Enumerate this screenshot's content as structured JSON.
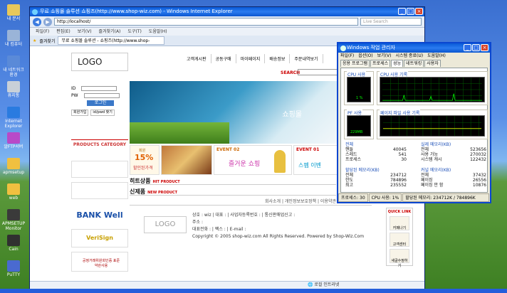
{
  "desktop_icons": [
    {
      "label": "내 문서",
      "color": "#e8c85a"
    },
    {
      "label": "내 컴퓨터",
      "color": "#9ab4d8"
    },
    {
      "label": "내 네트워크 환경",
      "color": "#5a8ad8"
    },
    {
      "label": "휴지통",
      "color": "#c8d0d8"
    },
    {
      "label": "Internet Explorer",
      "color": "#2a7be0"
    },
    {
      "label": "알FTP서버",
      "color": "#b84ac8"
    },
    {
      "label": "apmsetup",
      "color": "#f0c040"
    },
    {
      "label": "web",
      "color": "#f0c040"
    },
    {
      "label": "APMSETUP Monitor",
      "color": "#3a3a3a"
    },
    {
      "label": "Cain",
      "color": "#303030"
    },
    {
      "label": "PuTTY",
      "color": "#4a6ad0"
    }
  ],
  "ie": {
    "title": "무료 쇼핑몰 솔루션  쇼핑즈(http://www.shop-wiz.com) - Windows Internet Explorer",
    "url": "http://localhost/",
    "search_placeholder": "Live Search",
    "menu": [
      "파일(F)",
      "편집(E)",
      "보기(V)",
      "즐겨찾기(A)",
      "도구(T)",
      "도움말(H)"
    ],
    "favorites": "즐겨찾기",
    "tab_label": "무료 쇼핑몰 솔루션 - 쇼핑즈(http://www.shop-",
    "status": "로컬 인트라넷"
  },
  "site": {
    "logo": "LOGO",
    "gnb": [
      "고객게시판",
      "공동구매",
      "마이페이지",
      "배송정보",
      "주문내역보기"
    ],
    "search_label": "SEARCH",
    "login": {
      "id_label": "ID",
      "pw_label": "PW",
      "button": "로그인",
      "join": "회원가입",
      "find": "id/pwd 찾기"
    },
    "category": "PRODUCTS CATEGORY",
    "hero_text": "쇼핑몰",
    "banner1_pct": "15%",
    "banner1_sub": "할인된가격",
    "banner1_top": "회원",
    "event02": "EVENT 02",
    "event02_text": "즐거운 쇼핑",
    "event01": "EVENT 01",
    "event01_text": "스펨 이벤",
    "hit": "히트상품",
    "hit_sub": "HIT PRODUCT",
    "new": "신제품",
    "new_sub": "NEW PRODUCT",
    "footlinks": "회사소개 | 개인정보보호정책 | 이용약관",
    "footer_logo": "LOGO",
    "footer_lines": [
      "상호 : wiz | 대표 :  | 사업자등록번호 :  | 통신판매업신고 : ",
      "주소 : ",
      "대표전화 :  | 팩스 :  | E-mail : ",
      "Copyright © 2005 shop-wiz.com All Rights Reserved. Powered by Shop-Wiz.Com"
    ],
    "bankwell": "BANK Well",
    "verisign": "VeriSign",
    "cert_text": "공정거래위원회인증 표준약관사용",
    "quick": "QUICK LINK",
    "quick_items": [
      "카페나기",
      "고객센터",
      "새글수정하기"
    ]
  },
  "tm": {
    "title": "Windows 작업 관리자",
    "menu": [
      "파일(F)",
      "옵션(O)",
      "보기(V)",
      "시스템 종료(U)",
      "도움말(H)"
    ],
    "tabs": [
      "응용 프로그램",
      "프로세스",
      "성능",
      "네트워킹",
      "사용자"
    ],
    "cpu_usage": "CPU 사용",
    "cpu_pct": "1 %",
    "cpu_hist": "CPU 사용 기록",
    "pf_usage": "PF 사용",
    "pf_val": "229MB",
    "pf_hist": "페이지 파일 사용 기록",
    "totals_h": "전체",
    "totals": [
      [
        "핸들",
        "40045"
      ],
      [
        "스레드",
        "541"
      ],
      [
        "프로세스",
        "30"
      ]
    ],
    "phys_h": "실제 메모리(KB)",
    "phys": [
      [
        "전체",
        "523656"
      ],
      [
        "사용 가능",
        "270032"
      ],
      [
        "시스템 캐시",
        "122432"
      ]
    ],
    "commit_h": "할당된 메모리(KB)",
    "commit": [
      [
        "전체",
        "234712"
      ],
      [
        "한도",
        "784896"
      ],
      [
        "최고",
        "235552"
      ]
    ],
    "kernel_h": "커널 메모리(KB)",
    "kernel": [
      [
        "전체",
        "37432"
      ],
      [
        "페이징",
        "26556"
      ],
      [
        "페이징 안 함",
        "10876"
      ]
    ],
    "status": [
      "프로세스: 30",
      "CPU 사용: 1%",
      "할당된 메모리: 234712K / 784896K"
    ]
  }
}
